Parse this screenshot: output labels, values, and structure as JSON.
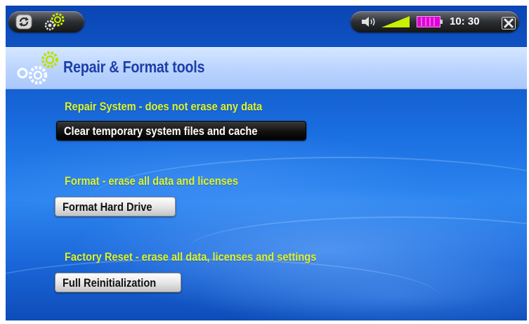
{
  "status_bar": {
    "icons": [
      "refresh-icon",
      "tools-gear-icon",
      "volume-icon",
      "signal-level-icon",
      "battery-icon",
      "close-icon"
    ],
    "time": "10: 30"
  },
  "header": {
    "title": "Repair & Format tools",
    "icon": "gears-icon"
  },
  "sections": [
    {
      "label": "Repair System - does not erase any data",
      "button": "Clear temporary system files and cache",
      "selected": true
    },
    {
      "label": "Format - erase all data and licenses",
      "button": "Format Hard Drive",
      "selected": false
    },
    {
      "label": "Factory Reset - erase all data, licenses and settings",
      "button": "Full Reinitialization",
      "selected": false
    }
  ],
  "colors": {
    "label_yellow": "#ddf22a",
    "title_blue": "#1d3fa8",
    "background_blue": "#1a6ee0",
    "signal_green": "#c8f000",
    "battery_magenta": "#e000d8"
  }
}
